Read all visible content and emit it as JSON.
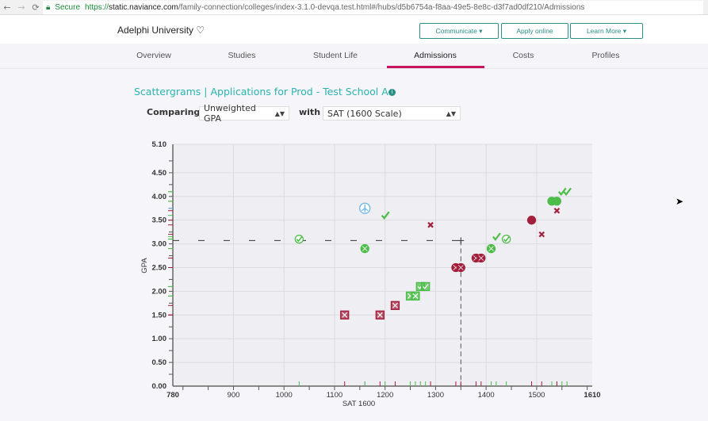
{
  "browser": {
    "secure_label": "Secure",
    "url_scheme": "https://",
    "url_domain": "static.naviance.com",
    "url_path": "/family-connection/colleges/index-3.1.0-devqa.test.html#/hubs/d5b6754a-f8aa-49e5-8e8c-d3f7ad0df210/Admissions"
  },
  "header": {
    "school_name": "Adelphi University",
    "communicate": "Communicate ▾",
    "apply": "Apply online",
    "learn_more": "Learn More ▾"
  },
  "tabs": [
    "Overview",
    "Studies",
    "Student Life",
    "Admissions",
    "Costs",
    "Profiles"
  ],
  "active_tab": "Admissions",
  "section": {
    "title": "Scattergrams | Applications for Prod - Test School A",
    "comparing_label": "Comparing",
    "comparing_value": "Unweighted GPA",
    "with_label": "with",
    "with_value": "SAT (1600 Scale)"
  },
  "colors": {
    "accepted": "#4cbd48",
    "denied": "#a3203c",
    "other": "#6cb6e8",
    "accent": "#2ab3b0",
    "tab_active": "#c8145e"
  },
  "chart_data": {
    "type": "scatter",
    "xlabel": "SAT 1600",
    "ylabel": "GPA",
    "xlim": [
      780,
      1610
    ],
    "ylim": [
      0,
      5.1
    ],
    "x_ticks": [
      "780",
      "900",
      "1000",
      "1100",
      "1200",
      "1300",
      "1400",
      "1500",
      "1610"
    ],
    "y_ticks": [
      "0.00",
      "0.50",
      "1.00",
      "1.50",
      "2.00",
      "2.50",
      "3.00",
      "3.50",
      "4.00",
      "4.50",
      "5.10"
    ],
    "grid": true,
    "student": {
      "x": 1350,
      "y": 3.07
    },
    "points": [
      {
        "x": 1030,
        "y": 3.1,
        "status": "accepted",
        "marker": "circle-check"
      },
      {
        "x": 1160,
        "y": 3.75,
        "status": "other",
        "marker": "circle-person"
      },
      {
        "x": 1160,
        "y": 2.9,
        "status": "accepted",
        "marker": "circle-dot"
      },
      {
        "x": 1200,
        "y": 3.6,
        "status": "accepted",
        "marker": "check"
      },
      {
        "x": 1290,
        "y": 3.4,
        "status": "denied",
        "marker": "x"
      },
      {
        "x": 1120,
        "y": 1.5,
        "status": "denied",
        "marker": "square-dot"
      },
      {
        "x": 1190,
        "y": 1.5,
        "status": "denied",
        "marker": "square-dot"
      },
      {
        "x": 1220,
        "y": 1.7,
        "status": "denied",
        "marker": "square-x"
      },
      {
        "x": 1250,
        "y": 1.9,
        "status": "accepted",
        "marker": "square-dot"
      },
      {
        "x": 1260,
        "y": 1.9,
        "status": "accepted",
        "marker": "square-dot"
      },
      {
        "x": 1270,
        "y": 2.1,
        "status": "accepted",
        "marker": "square-check"
      },
      {
        "x": 1280,
        "y": 2.1,
        "status": "accepted",
        "marker": "square-check"
      },
      {
        "x": 1340,
        "y": 2.5,
        "status": "denied",
        "marker": "circle-dot"
      },
      {
        "x": 1350,
        "y": 2.5,
        "status": "denied",
        "marker": "circle-dot"
      },
      {
        "x": 1380,
        "y": 2.7,
        "status": "denied",
        "marker": "circle-x"
      },
      {
        "x": 1390,
        "y": 2.7,
        "status": "denied",
        "marker": "circle-x"
      },
      {
        "x": 1410,
        "y": 2.9,
        "status": "accepted",
        "marker": "circle-dot"
      },
      {
        "x": 1420,
        "y": 3.15,
        "status": "accepted",
        "marker": "check"
      },
      {
        "x": 1440,
        "y": 3.1,
        "status": "accepted",
        "marker": "circle-check"
      },
      {
        "x": 1490,
        "y": 3.5,
        "status": "denied",
        "marker": "circle"
      },
      {
        "x": 1510,
        "y": 3.2,
        "status": "denied",
        "marker": "x"
      },
      {
        "x": 1530,
        "y": 3.9,
        "status": "accepted",
        "marker": "circle"
      },
      {
        "x": 1540,
        "y": 3.9,
        "status": "accepted",
        "marker": "circle"
      },
      {
        "x": 1540,
        "y": 3.7,
        "status": "denied",
        "marker": "x"
      },
      {
        "x": 1550,
        "y": 4.1,
        "status": "accepted",
        "marker": "check"
      },
      {
        "x": 1560,
        "y": 4.1,
        "status": "accepted",
        "marker": "check"
      }
    ]
  }
}
